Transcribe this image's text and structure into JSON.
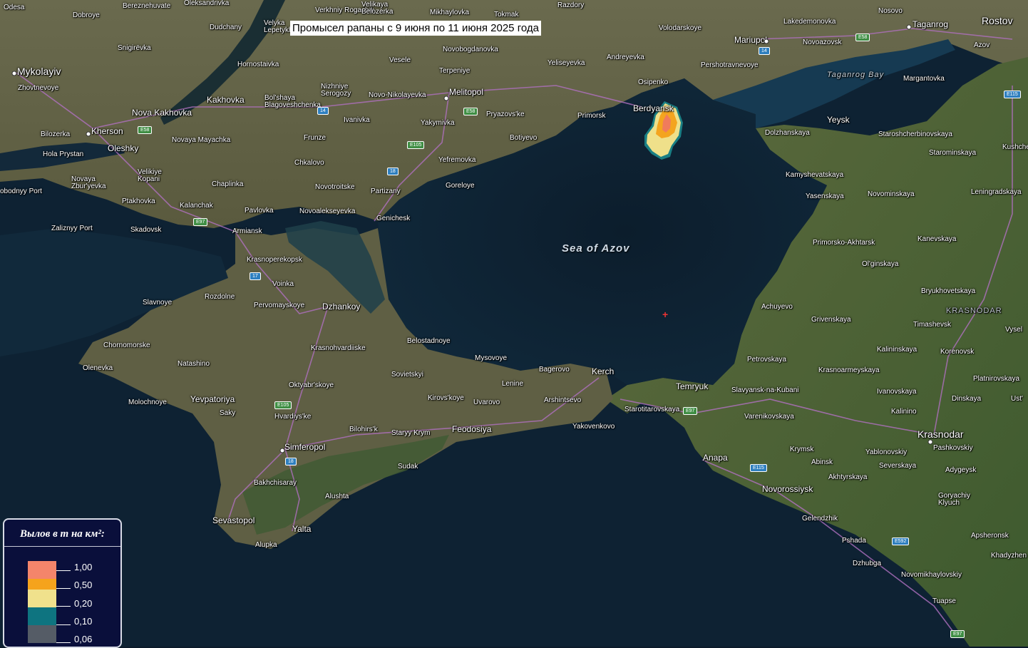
{
  "title": "Промысел рапаны с 9 июня по 11 июня 2025 года",
  "legend": {
    "title": "Вылов в т на км²:",
    "items": [
      {
        "value": "1,00",
        "color": "#f4856b"
      },
      {
        "value": "0,50",
        "color": "#f5a31c"
      },
      {
        "value": "0,20",
        "color": "#f0e18c"
      },
      {
        "value": "0,10",
        "color": "#0e7480"
      },
      {
        "value": "0,06",
        "color": "#555c66"
      }
    ]
  },
  "map_labels": {
    "odesa": "Odesa",
    "mykolaiv": "Mykolayiv",
    "kherson": "Kherson",
    "nova_kakhovka": "Nova Kakhovka",
    "kakhovka": "Kakhovka",
    "melitopol": "Melitopol",
    "berdyansk": "Berdyansk",
    "mariupol": "Mariupol",
    "taganrog": "Taganrog",
    "rostov": "Rostov",
    "azov": "Azov",
    "yeysk": "Yeysk",
    "genichesk": "Genichesk",
    "dzhankoy": "Dzhankoy",
    "simferopol": "Simferopol",
    "sevastopol": "Sevastopol",
    "yalta": "Yalta",
    "alushta": "Alushta",
    "feodosiya": "Feodosiya",
    "kerch": "Kerch",
    "temryuk": "Temryuk",
    "anapa": "Anapa",
    "novorossiysk": "Novorossiysk",
    "krasnodar": "Krasnodar",
    "yevpatoriya": "Yevpatoriya",
    "armiansk": "Armiansk",
    "krasnoperekopsk": "Krasnoperekopsk",
    "sea_of_azov": "Sea of Azov",
    "taganrog_bay": "Taganrog Bay",
    "krasnodar_region": "KRASNODAR",
    "gelendzhik": "Gelendzhik",
    "tuapse": "Tuapse",
    "primorsko": "Primorsko-Akhtarsk",
    "kurortne": "Bakhchisaray",
    "sudak": "Sudak",
    "chornomorske": "Chornomorske",
    "olenevka": "Olenevka",
    "skadovsk": "Skadovsk",
    "zaliznyy": "Zaliznyy Port",
    "pavlovka": "Pavlovka",
    "chaplinka": "Chaplinka",
    "kalanchak": "Kalanchak",
    "nova_ptakhovka": "Ptakhovka",
    "oleshky": "Oleshky",
    "hola": "Hola Prystan",
    "bilozerka": "Bilozerka",
    "dudchany": "Dudchany",
    "snigirevka": "Snigirëvka",
    "zhovtnevoye": "Zhovtnevoye",
    "dobroye": "Dobroye",
    "bereznehuvate": "Bereznehuvate",
    "oleksandrivka": "Oleksandrivka",
    "velyka_lepetykha": "Velyka Lepetykha",
    "verkhniy": "Verkhniy Rogachik",
    "velikaya_belozerka": "Velikaya Belozërka",
    "mikhaylovka": "Mikhaylovka",
    "tokmak": "Tokmak",
    "razdory": "Razdory",
    "volodarskoye": "Volodarskoye",
    "nosovo": "Nosovo",
    "lakedemonovka": "Lakedemonovka",
    "novoazovsk": "Novoazovsk",
    "hornostaivka": "Hornostaivka",
    "vesele": "Vesele",
    "novobogdanovka": "Novobogdanovka",
    "terpeniye": "Terpeniye",
    "yeliseyevka": "Yeliseyevka",
    "andreyevka": "Andreyevka",
    "pershotravnevoye": "Pershotravnevoye",
    "osipenko": "Osipenko",
    "nizhniye": "Nizhniye Serogozy",
    "novo_nikolayevka": "Novo-Nikolayevka",
    "bolshaya": "Bol'shaya Blagoveshchenka",
    "ivanivka": "Ivanivka",
    "pryazovske": "Pryazovs'ke",
    "primorsk": "Primorsk",
    "yakymivka": "Yakymivka",
    "botiyevo": "Botiyevo",
    "frunze": "Frunze",
    "chkalovo": "Chkalovo",
    "yefremovka": "Yefremovka",
    "goreloye": "Goreloye",
    "novotroitske": "Novotroitske",
    "partizany": "Partizany",
    "novoalekseyevka": "Novoalekseyevka",
    "margantovka": "Margantovka",
    "dolzhanskaya": "Dolzhanskaya",
    "starosh": "Staroshcherbinovskaya",
    "starominskaya": "Starominskaya",
    "kushchevskaya": "Kushche",
    "kamyshevatskaya": "Kamyshevatskaya",
    "yasenskaya": "Yasenskaya",
    "novominskaya": "Novominskaya",
    "leningradskaya": "Leningradskaya",
    "kanevskaya": "Kanevskaya",
    "olginskaya": "Ol'ginskaya",
    "bryukhovetskaya": "Bryukhovetskaya",
    "achuyevo": "Achuyevo",
    "grivenskaya": "Grivenskaya",
    "timashevsk": "Timashevsk",
    "vyselki": "Vysel",
    "kalininskaya": "Kalininskaya",
    "korenovsk": "Korenovsk",
    "petrovskaya": "Petrovskaya",
    "krasnoarmeyskaya": "Krasnoarmeyskaya",
    "platnirovskaya": "Platnirovskaya",
    "slavyansk": "Slavyansk-na-Kubani",
    "ivanovskaya": "Ivanovskaya",
    "dinskaya": "Dinskaya",
    "kalinino": "Kalinino",
    "ust": "Ust'",
    "varenikovskaya": "Varenikovskaya",
    "starotitarovskaya": "Starotitarovskaya",
    "krymsk": "Krymsk",
    "pashkovskiy": "Pashkovskiy",
    "abinsk": "Abinsk",
    "yablonovskiy": "Yablonovskiy",
    "severskaya": "Severskaya",
    "adygeysk": "Adygeysk",
    "akhtyrskaya": "Akhtyrskaya",
    "goryachiy": "Goryachiy Klyuch",
    "apsheronsk": "Apsheronsk",
    "khadyzhensk": "Khadyzhen",
    "pshada": "Pshada",
    "dzhubga": "Dzhubga",
    "novomikhaylovskiy": "Novomikhaylovskiy",
    "yakovenkovo": "Yakovenkovo",
    "arshintsevo": "Arshintsevo",
    "bagerovo": "Bagerovo",
    "lenine": "Lenine",
    "mysovoye": "Mysovoye",
    "uvarovo": "Uvarovo",
    "kirovskoye": "Kirovs'koye",
    "staryy_krym": "Staryy Krym",
    "bilohirsk": "Bilohirs'k",
    "sovietskyi": "Sovietskyi",
    "belostadnoye": "Belostadnoye",
    "krasnohvardiiske": "Krasnohvardiiske",
    "oktyabrskoye": "Oktyabr'skoye",
    "hvardiyske": "Hvardiys'ke",
    "saky": "Saky",
    "molochnoye": "Molochnoye",
    "natashino": "Natashino",
    "slavnoye": "Slavnoye",
    "rozdolne": "Rozdolne",
    "pervomayskoye": "Pervomayskoye",
    "voinka": "Voinka",
    "alupka": "Alupka",
    "novaya_zburyevka": "Novaya Zbur'yevka",
    "velikiye_kopani": "Velikiye Kopani",
    "novaya_mayachka": "Novaya Mayachka",
    "svobodnyy": "obodnyy Port"
  }
}
